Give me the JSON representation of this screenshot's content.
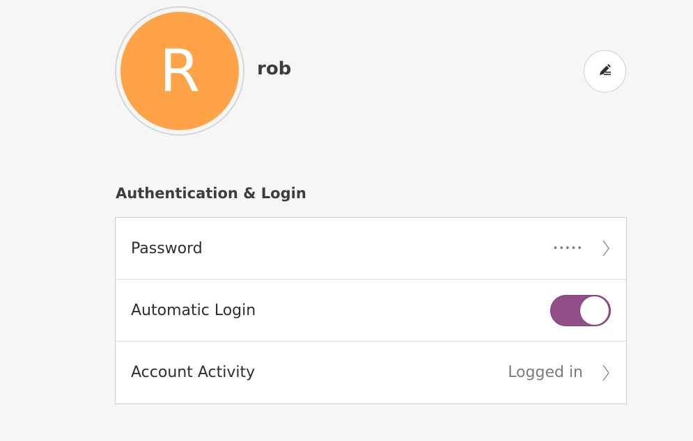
{
  "user": {
    "avatar_letter": "R",
    "name": "rob",
    "avatar_color": "#ffa348"
  },
  "edit_button": {
    "icon": "edit-pencil-icon"
  },
  "auth_section": {
    "title": "Authentication & Login",
    "rows": [
      {
        "label": "Password",
        "value": "•••••",
        "icon": "chevron-right-icon"
      },
      {
        "label": "Automatic Login",
        "toggle_on": true,
        "toggle_color": "#924d8b"
      },
      {
        "label": "Account Activity",
        "value": "Logged in",
        "icon": "chevron-right-icon"
      }
    ]
  }
}
